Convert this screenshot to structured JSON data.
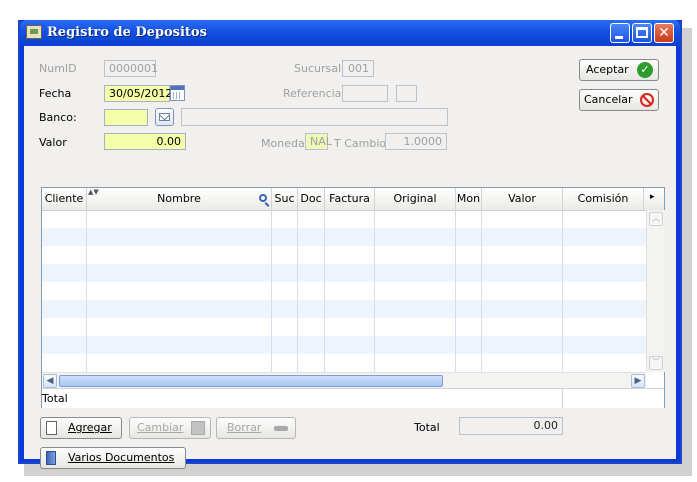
{
  "window": {
    "title": "Registro de Depositos"
  },
  "form": {
    "numid_label": "NumID",
    "numid_value": "0000001",
    "sucursal_label": "Sucursal",
    "sucursal_value": "001",
    "fecha_label": "Fecha",
    "fecha_value": "30/05/2012",
    "referencia_label": "Referencia",
    "banco_label": "Banco:",
    "banco_value": "",
    "valor_label": "Valor",
    "valor_value": "0.00",
    "moneda_label": "Moneda",
    "moneda_value": "NAL",
    "tcambio_label": "T Cambio",
    "tcambio_value": "1.0000"
  },
  "actions": {
    "accept_label": "Aceptar",
    "cancel_label": "Cancelar"
  },
  "grid": {
    "columns": [
      "Cliente",
      "Nombre",
      "Suc",
      "Doc",
      "Factura",
      "Original",
      "Mon",
      "Valor",
      "Comisión"
    ],
    "footer_label": "Total"
  },
  "bottom": {
    "add_label": "Agregar",
    "change_label": "Cambiar",
    "delete_label": "Borrar",
    "various_label": "Varios Documentos",
    "total_label": "Total",
    "total_value": "0.00"
  },
  "colors": {
    "title_bar": "#1450e0",
    "required_field": "#f5ffa8",
    "accept_icon": "#2f9b2f",
    "cancel_icon": "#d9251d"
  },
  "icons": [
    "app-icon",
    "calendar-icon",
    "envelope-icon",
    "check-icon",
    "no-icon",
    "search-icon",
    "document-icon",
    "picture-icon",
    "minus-icon",
    "documents-icon"
  ]
}
